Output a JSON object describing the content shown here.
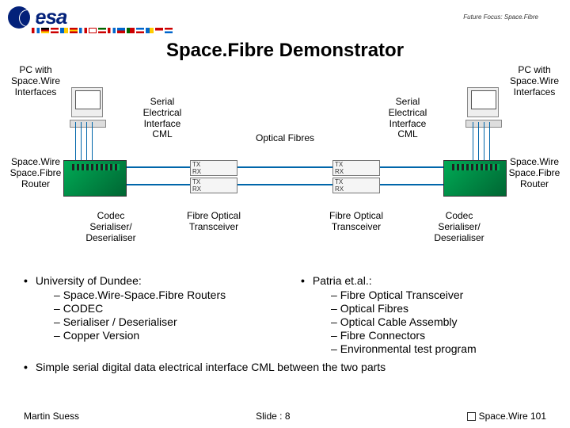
{
  "header": {
    "logo_text": "esa",
    "tagline": "Future Focus: Space.Fibre"
  },
  "title": "Space.Fibre Demonstrator",
  "labels": {
    "pc_left": "PC with\nSpace.Wire\nInterfaces",
    "pc_right": "PC with\nSpace.Wire\nInterfaces",
    "serial_cml": "Serial\nElectrical\nInterface\nCML",
    "optical_fibres": "Optical Fibres",
    "router": "Space.Wire\nSpace.Fibre\nRouter",
    "codec": "Codec\nSerialiser/\nDeserialiser",
    "fotrans": "Fibre Optical\nTransceiver"
  },
  "bullets": {
    "left_head": "University of Dundee:",
    "left_items": [
      "Space.Wire-Space.Fibre Routers",
      "CODEC",
      "Serialiser / Deserialiser",
      "Copper Version"
    ],
    "right_head": "Patria et.al.:",
    "right_items": [
      "Fibre Optical Transceiver",
      "Optical Fibres",
      "Optical Cable Assembly",
      "Fibre Connectors",
      "Environmental test program"
    ]
  },
  "summary": "Simple serial digital data electrical interface CML between the two parts",
  "footer": {
    "author": "Martin Suess",
    "slide": "Slide : 8",
    "series": "Space.Wire 101"
  }
}
